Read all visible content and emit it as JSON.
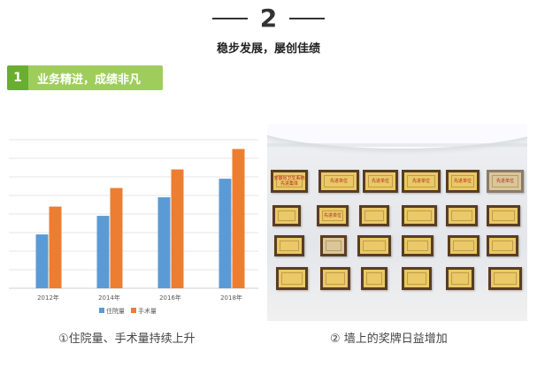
{
  "section": {
    "number": "2",
    "title": "稳步发展，屡创佳绩"
  },
  "badge": {
    "number": "1",
    "text": "业务精进，成绩非凡"
  },
  "colors": {
    "badge_dark": "#6aae2f",
    "badge_light": "#9fcd5c",
    "series_inpatient": "#5b9bd5",
    "series_surgery": "#ed7d31"
  },
  "chart_data": {
    "type": "bar",
    "categories": [
      "2012年",
      "",
      "2014年",
      "",
      "2016年",
      "",
      "2018年",
      ""
    ],
    "x_tick_labels": [
      "2012年",
      "2014年",
      "2016年",
      "2018年"
    ],
    "series": [
      {
        "name": "住院量",
        "values": [
          29,
          39,
          49,
          59
        ]
      },
      {
        "name": "手术量",
        "values": [
          44,
          54,
          64,
          75
        ]
      }
    ],
    "ylim": [
      0,
      80
    ],
    "grid": true,
    "legend": "bottom"
  },
  "captions": {
    "left": "①住院量、手术量持续上升",
    "right": "② 墙上的奖牌日益增加"
  },
  "photo": {
    "plaques": [
      {
        "text": "安徽省卫生系统先进集体"
      },
      {
        "text": "先进单位"
      },
      {
        "text": "先进单位"
      },
      {
        "text": "先进单位"
      },
      {
        "text": "先进单位"
      },
      {
        "text": "先进单位"
      },
      {
        "text": "先进单位"
      }
    ]
  }
}
